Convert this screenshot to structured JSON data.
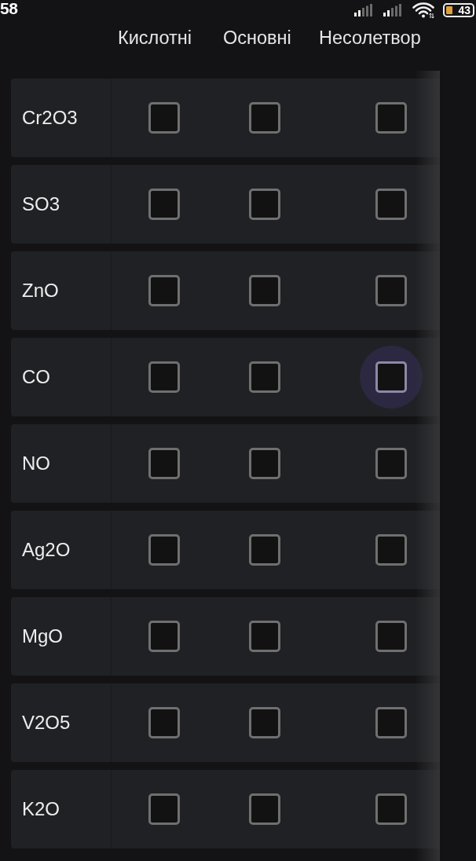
{
  "status_bar": {
    "time": "58",
    "battery": "43"
  },
  "columns": [
    "Кислотні",
    "Основні",
    "Несолетвор"
  ],
  "rows": [
    {
      "formula": "Cr2O3",
      "checks": [
        {
          "checked": false,
          "focused": false
        },
        {
          "checked": false,
          "focused": false
        },
        {
          "checked": false,
          "focused": false
        }
      ]
    },
    {
      "formula": "SO3",
      "checks": [
        {
          "checked": false,
          "focused": false
        },
        {
          "checked": false,
          "focused": false
        },
        {
          "checked": false,
          "focused": false
        }
      ]
    },
    {
      "formula": "ZnO",
      "checks": [
        {
          "checked": false,
          "focused": false
        },
        {
          "checked": false,
          "focused": false
        },
        {
          "checked": false,
          "focused": false
        }
      ]
    },
    {
      "formula": "CO",
      "checks": [
        {
          "checked": false,
          "focused": false
        },
        {
          "checked": false,
          "focused": false
        },
        {
          "checked": false,
          "focused": true
        }
      ]
    },
    {
      "formula": "NO",
      "checks": [
        {
          "checked": false,
          "focused": false
        },
        {
          "checked": false,
          "focused": false
        },
        {
          "checked": false,
          "focused": false
        }
      ]
    },
    {
      "formula": "Ag2O",
      "checks": [
        {
          "checked": false,
          "focused": false
        },
        {
          "checked": false,
          "focused": false
        },
        {
          "checked": false,
          "focused": false
        }
      ]
    },
    {
      "formula": "MgO",
      "checks": [
        {
          "checked": false,
          "focused": false
        },
        {
          "checked": false,
          "focused": false
        },
        {
          "checked": false,
          "focused": false
        }
      ]
    },
    {
      "formula": "V2O5",
      "checks": [
        {
          "checked": false,
          "focused": false
        },
        {
          "checked": false,
          "focused": false
        },
        {
          "checked": false,
          "focused": false
        }
      ]
    },
    {
      "formula": "K2O",
      "checks": [
        {
          "checked": false,
          "focused": false
        },
        {
          "checked": false,
          "focused": false
        },
        {
          "checked": false,
          "focused": false
        }
      ]
    }
  ]
}
